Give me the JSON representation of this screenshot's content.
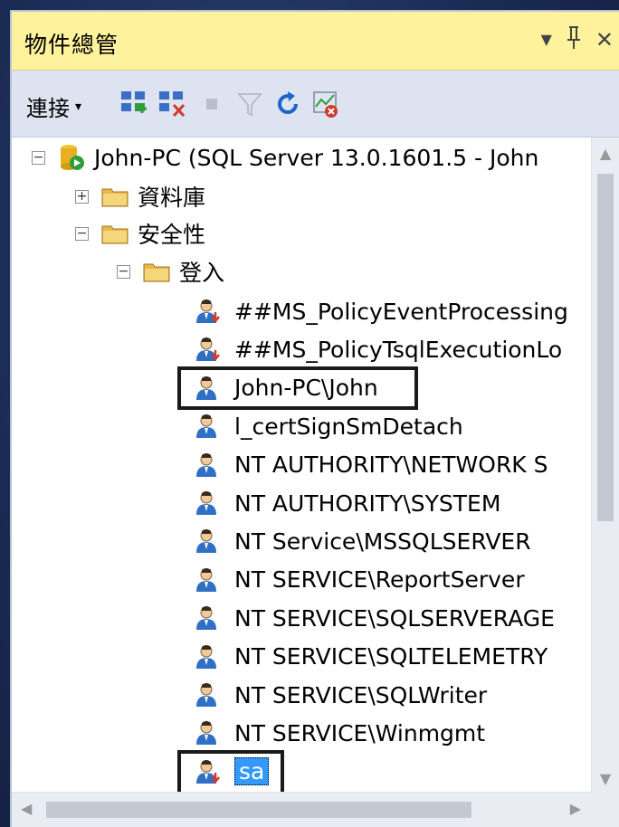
{
  "window": {
    "title": "物件總管",
    "dropdown_icon": "▼",
    "pin_icon": "ᅟ",
    "close_icon": "✕"
  },
  "toolbar": {
    "connect_label": "連接",
    "connect_caret": "▾",
    "buttons": [
      "connect-object-explorer-icon",
      "disconnect-icon",
      "stop-icon",
      "filter-icon",
      "refresh-icon",
      "activity-monitor-icon"
    ]
  },
  "tree": {
    "server": "John-PC (SQL Server 13.0.1601.5 - John",
    "databases": "資料庫",
    "security": "安全性",
    "logins": "登入",
    "login_items": [
      "##MS_PolicyEventProcessing",
      "##MS_PolicyTsqlExecutionLo",
      "John-PC\\John",
      "l_certSignSmDetach",
      "NT AUTHORITY\\NETWORK S",
      "NT AUTHORITY\\SYSTEM",
      "NT Service\\MSSQLSERVER",
      "NT SERVICE\\ReportServer",
      "NT SERVICE\\SQLSERVERAGE",
      "NT SERVICE\\SQLTELEMETRY",
      "NT SERVICE\\SQLWriter",
      "NT SERVICE\\Winmgmt",
      "sa"
    ],
    "expand_minus": "−",
    "expand_plus": "+"
  },
  "colors": {
    "title_bg": "#fff29d",
    "toolbar_bg": "#dde3f1",
    "selection": "#3399ff",
    "highlight_border": "#1a1a1a"
  }
}
